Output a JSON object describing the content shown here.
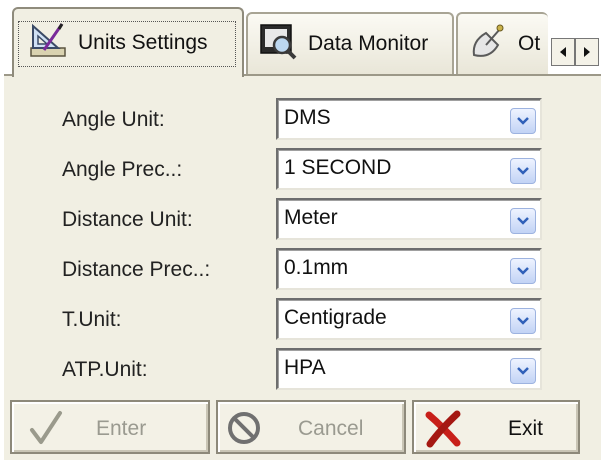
{
  "tabs": {
    "units_settings": "Units Settings",
    "data_monitor": "Data Monitor",
    "other": "Ot"
  },
  "icons": {
    "units_settings": "ruler-triangle-icon",
    "data_monitor": "magnifier-monitor-icon",
    "other": "satellite-dish-icon",
    "scroll_left": "chevron-left-icon",
    "scroll_right": "chevron-right-icon",
    "dropdown": "chevron-down-icon",
    "enter": "checkmark-icon",
    "cancel": "no-entry-icon",
    "exit": "red-x-icon"
  },
  "fields": [
    {
      "label": "Angle Unit:",
      "value": "DMS"
    },
    {
      "label": "Angle Prec..:",
      "value": "1 SECOND"
    },
    {
      "label": "Distance Unit:",
      "value": "Meter"
    },
    {
      "label": "Distance Prec..:",
      "value": "0.1mm"
    },
    {
      "label": "T.Unit:",
      "value": "Centigrade"
    },
    {
      "label": "ATP.Unit:",
      "value": "HPA"
    }
  ],
  "buttons": {
    "enter": "Enter",
    "cancel": "Cancel",
    "exit": "Exit"
  },
  "colors": {
    "panel_background": "#f1efe3",
    "dropdown_arrow": "#3060b8",
    "exit_icon": "#c8201a"
  }
}
